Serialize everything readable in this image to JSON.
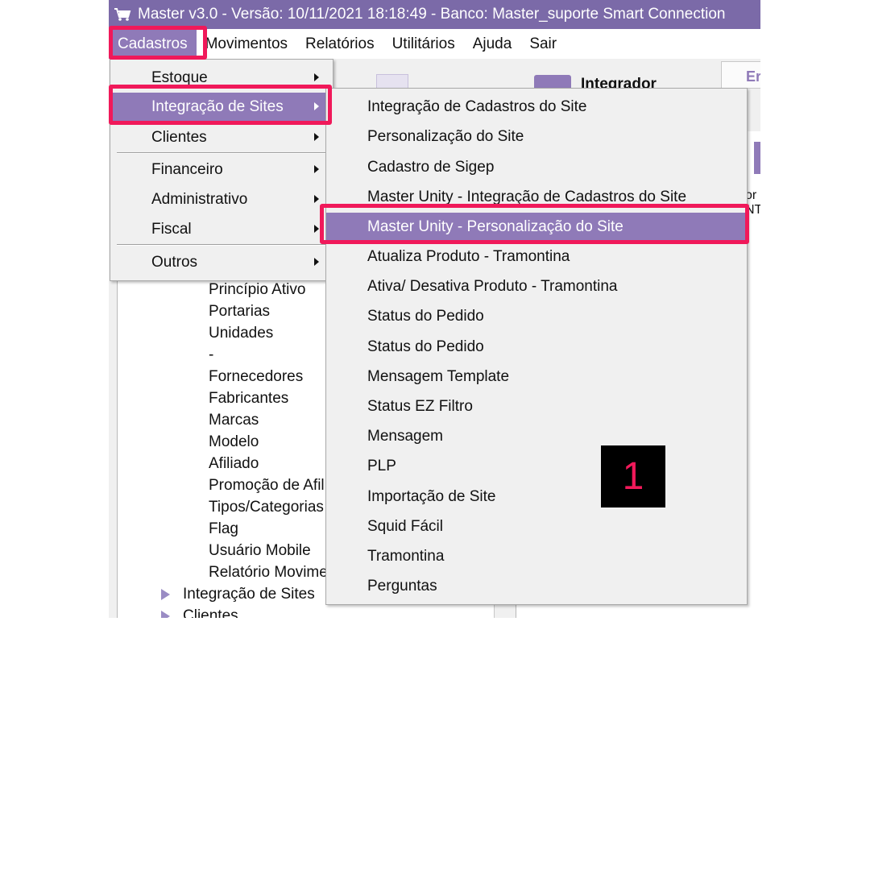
{
  "window": {
    "title": "Master  v3.0 -  Versão: 10/11/2021 18:18:49 - Banco: Master_suporte Smart Connection",
    "accent_color": "#7b6aa8",
    "highlight_color": "#8f7ab8",
    "callout_color": "#f0195a"
  },
  "menubar": {
    "items": [
      {
        "label": "Cadastros",
        "active": true
      },
      {
        "label": "Movimentos"
      },
      {
        "label": "Relatórios"
      },
      {
        "label": "Utilitários"
      },
      {
        "label": "Ajuda"
      },
      {
        "label": "Sair"
      }
    ]
  },
  "background": {
    "integrador_label": "Integrador",
    "tab_label": "Er",
    "side_text_1": "or",
    "side_text_2": "NT"
  },
  "tree": {
    "items": [
      "Princípio Ativo",
      "Portarias",
      "Unidades",
      "-",
      "Fornecedores",
      "Fabricantes",
      "Marcas",
      "Modelo",
      "Afiliado",
      "Promoção de Afil",
      "Tipos/Categorias",
      "Flag",
      "Usuário Mobile",
      "Relatório Movime"
    ],
    "groups": [
      "Integração de Sites",
      "Clientes"
    ]
  },
  "menu_cadastros": {
    "items": [
      {
        "label": "Estoque",
        "submenu": true
      },
      {
        "label": "Integração de Sites",
        "submenu": true,
        "highlighted": true
      },
      {
        "label": "Clientes",
        "submenu": true
      },
      {
        "label": "Financeiro",
        "submenu": true
      },
      {
        "label": "Administrativo",
        "submenu": true
      },
      {
        "label": "Fiscal",
        "submenu": true
      },
      {
        "label": "Outros",
        "submenu": true
      }
    ]
  },
  "menu_integracao": {
    "items": [
      {
        "label": "Integração de Cadastros do Site"
      },
      {
        "label": "Personalização do Site"
      },
      {
        "label": "Cadastro de Sigep"
      },
      {
        "label": "Master Unity - Integração de Cadastros do Site"
      },
      {
        "label": "Master Unity - Personalização do Site",
        "highlighted": true
      },
      {
        "label": "Atualiza Produto - Tramontina"
      },
      {
        "label": "Ativa/ Desativa Produto - Tramontina"
      },
      {
        "label": "Status do Pedido"
      },
      {
        "label": "Status do Pedido"
      },
      {
        "label": "Mensagem Template"
      },
      {
        "label": "Status EZ Filtro"
      },
      {
        "label": "Mensagem"
      },
      {
        "label": "PLP"
      },
      {
        "label": "Importação de Site"
      },
      {
        "label": "Squid Fácil"
      },
      {
        "label": "Tramontina"
      },
      {
        "label": "Perguntas"
      }
    ]
  },
  "step_badge": "1"
}
